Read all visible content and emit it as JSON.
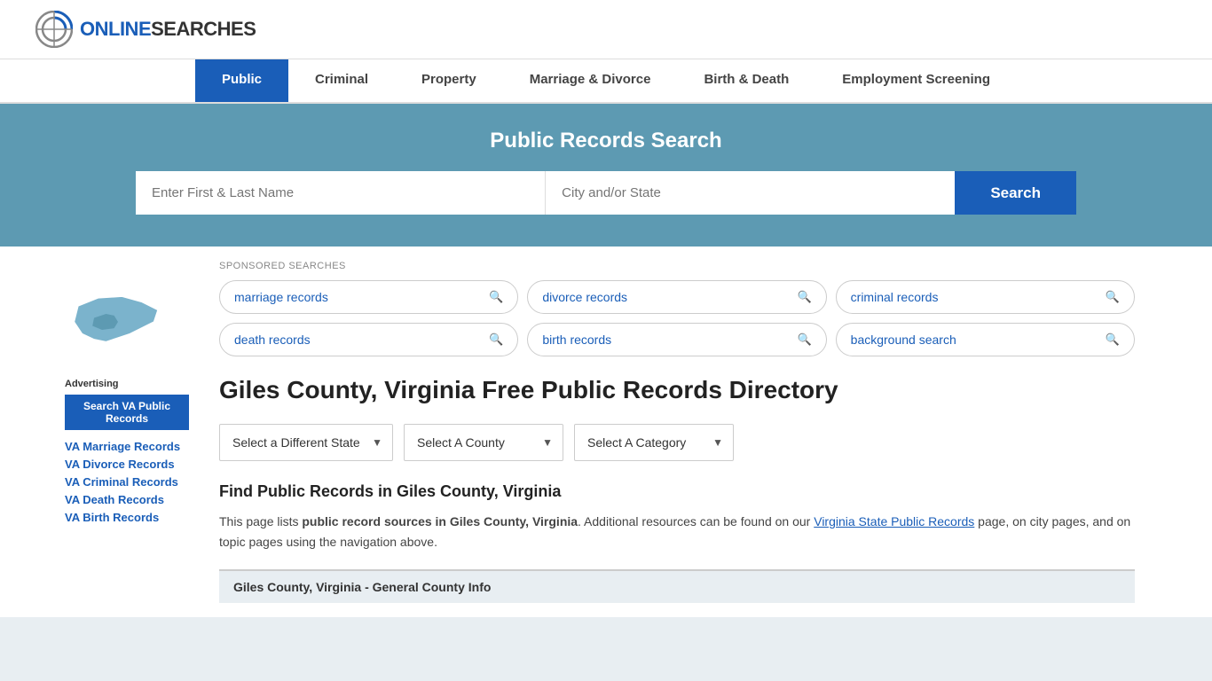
{
  "logo": {
    "text_online": "ONLINE",
    "text_searches": "SEARCHES"
  },
  "nav": {
    "items": [
      {
        "label": "Public",
        "active": true
      },
      {
        "label": "Criminal",
        "active": false
      },
      {
        "label": "Property",
        "active": false
      },
      {
        "label": "Marriage & Divorce",
        "active": false
      },
      {
        "label": "Birth & Death",
        "active": false
      },
      {
        "label": "Employment Screening",
        "active": false
      }
    ]
  },
  "hero": {
    "title": "Public Records Search",
    "name_placeholder": "Enter First & Last Name",
    "location_placeholder": "City and/or State",
    "search_button": "Search"
  },
  "sponsored": {
    "label": "SPONSORED SEARCHES",
    "pills": [
      {
        "text": "marriage records"
      },
      {
        "text": "divorce records"
      },
      {
        "text": "criminal records"
      },
      {
        "text": "death records"
      },
      {
        "text": "birth records"
      },
      {
        "text": "background search"
      }
    ]
  },
  "page": {
    "heading": "Giles County, Virginia Free Public Records Directory",
    "dropdowns": {
      "state": "Select a Different State",
      "county": "Select A County",
      "category": "Select A Category"
    },
    "find_title": "Find Public Records in Giles County, Virginia",
    "find_text_1": "This page lists ",
    "find_text_bold": "public record sources in Giles County, Virginia",
    "find_text_2": ". Additional resources can be found on our ",
    "find_link_text": "Virginia State Public Records",
    "find_text_3": " page, on city pages, and on topic pages using the navigation above.",
    "county_info_title": "Giles County, Virginia - General County Info"
  },
  "sidebar": {
    "advertising_label": "Advertising",
    "ad_button": "Search VA Public Records",
    "links": [
      {
        "text": "VA Marriage Records"
      },
      {
        "text": "VA Divorce Records"
      },
      {
        "text": "VA Criminal Records"
      },
      {
        "text": "VA Death Records"
      },
      {
        "text": "VA Birth Records"
      }
    ]
  }
}
